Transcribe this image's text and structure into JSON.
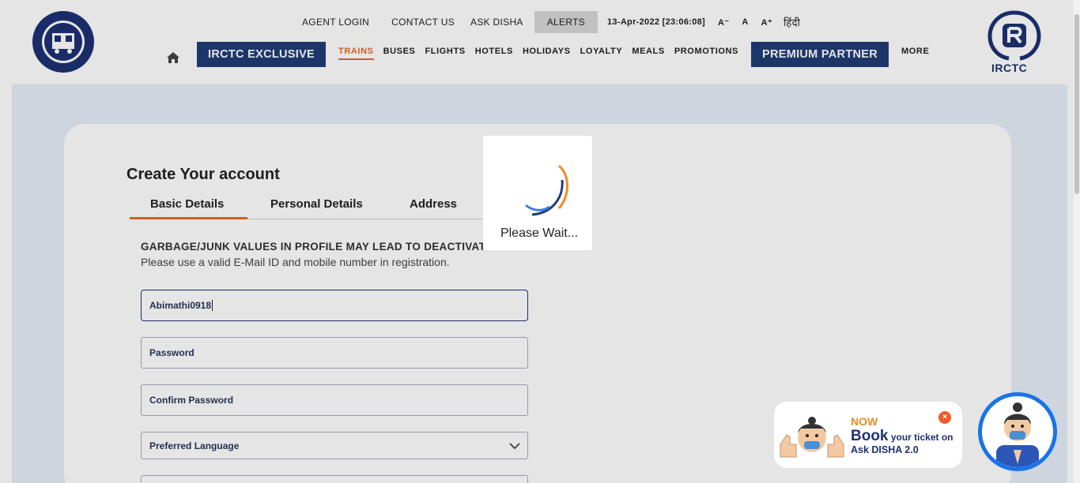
{
  "header": {
    "topbar": {
      "agent_login": "AGENT LOGIN",
      "contact_us": "CONTACT US",
      "ask_disha": "ASK DISHA",
      "alerts": "ALERTS",
      "datetime": "13-Apr-2022 [23:06:08]",
      "font_small": "A⁻",
      "font_normal": "A",
      "font_large": "A⁺",
      "hindi": "हिंदी"
    },
    "nav": {
      "exclusive": "IRCTC EXCLUSIVE",
      "items": [
        "TRAINS",
        "BUSES",
        "FLIGHTS",
        "HOTELS",
        "HOLIDAYS",
        "LOYALTY",
        "MEALS",
        "PROMOTIONS"
      ],
      "premium": "PREMIUM PARTNER",
      "more": "MORE"
    },
    "brand_right": "IRCTC"
  },
  "form": {
    "title": "Create Your account",
    "tabs": [
      "Basic Details",
      "Personal Details",
      "Address"
    ],
    "warning_title": "GARBAGE/JUNK VALUES IN PROFILE MAY LEAD TO DEACTIVATION",
    "warning_sub": "Please use a valid E-Mail ID and mobile number in registration.",
    "username_value": "Abimathi0918",
    "password_placeholder": "Password",
    "confirm_placeholder": "Confirm Password",
    "language_placeholder": "Preferred Language"
  },
  "loader": {
    "text": "Please Wait..."
  },
  "disha": {
    "now": "NOW",
    "book": "Book",
    "book_rest": " your ticket on",
    "ask": "Ask DISHA 2.0",
    "close": "×"
  },
  "colors": {
    "brand_blue": "#213d77",
    "accent_orange": "#e66b25"
  }
}
